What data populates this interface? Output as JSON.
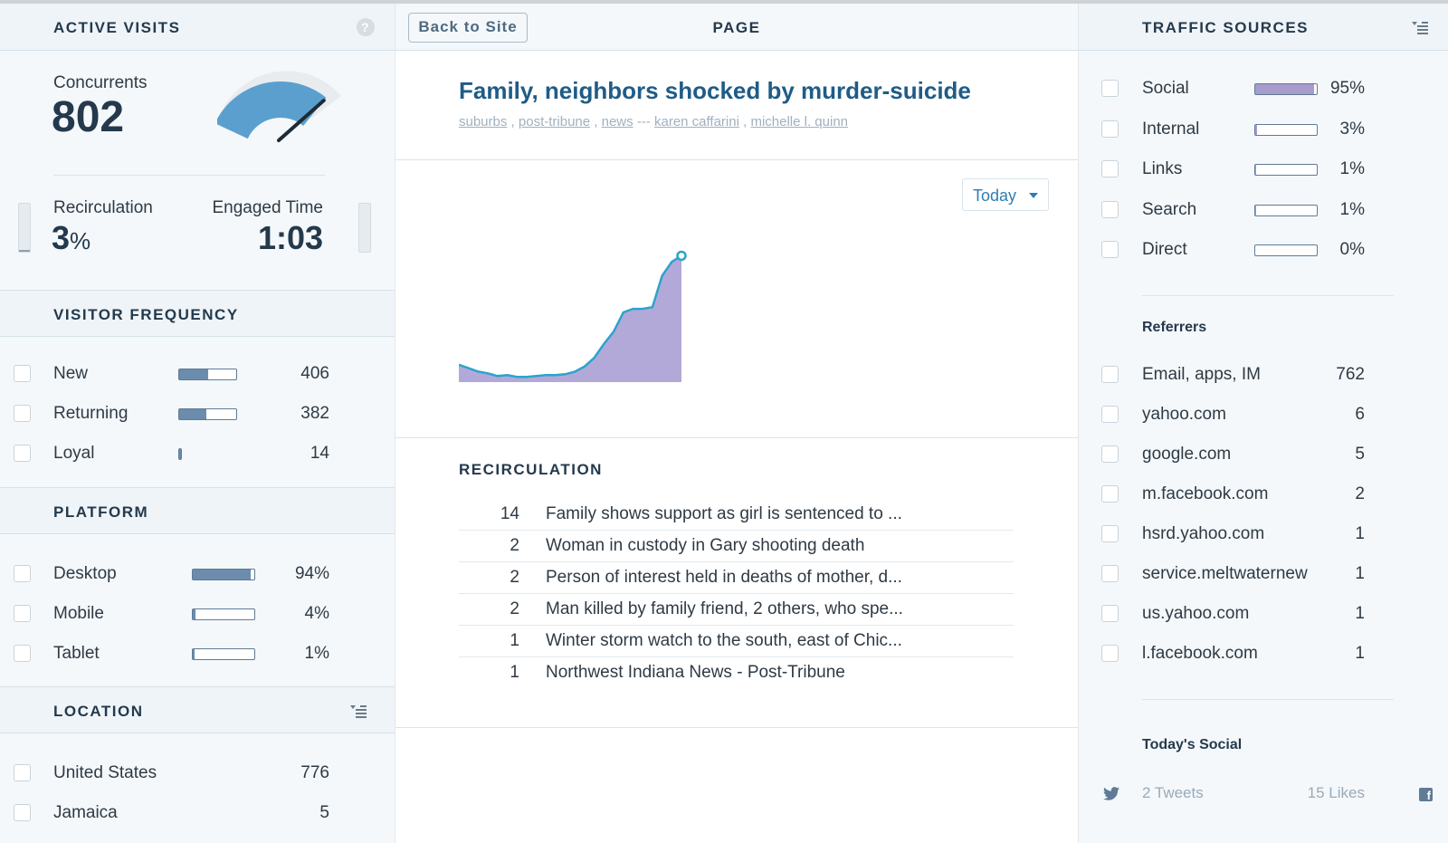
{
  "active_visits": {
    "title": "ACTIVE VISITS",
    "help_icon": "?",
    "concurrents_label": "Concurrents",
    "concurrents_value": "802",
    "gauge_fraction": 0.8,
    "recirculation_label": "Recirculation",
    "recirculation_value": "3",
    "recirculation_unit": "%",
    "engaged_label": "Engaged Time",
    "engaged_value": "1:03"
  },
  "visitor_frequency": {
    "title": "VISITOR FREQUENCY",
    "items": [
      {
        "label": "New",
        "value": "406",
        "fraction": 0.51
      },
      {
        "label": "Returning",
        "value": "382",
        "fraction": 0.48
      },
      {
        "label": "Loyal",
        "value": "14",
        "fraction": 0.02
      }
    ]
  },
  "platform": {
    "title": "PLATFORM",
    "items": [
      {
        "label": "Desktop",
        "value": "94%",
        "fraction": 0.94
      },
      {
        "label": "Mobile",
        "value": "4%",
        "fraction": 0.04
      },
      {
        "label": "Tablet",
        "value": "1%",
        "fraction": 0.01
      }
    ]
  },
  "location": {
    "title": "LOCATION",
    "items": [
      {
        "label": "United States",
        "value": "776"
      },
      {
        "label": "Jamaica",
        "value": "5"
      }
    ]
  },
  "page": {
    "title": "PAGE",
    "back_label": "Back to Site",
    "article_title": "Family, neighbors shocked by murder-suicide",
    "tags": [
      "suburbs",
      "post-tribune",
      "news"
    ],
    "authors": [
      "karen caffarini",
      "michelle l. quinn"
    ],
    "tag_sep": " , ",
    "author_sep": " --- ",
    "range_label": "Today"
  },
  "chart_data": {
    "type": "area",
    "title": "",
    "xlabel": "",
    "ylabel": "",
    "x": [
      0,
      1,
      2,
      3,
      4,
      5,
      6,
      7,
      8,
      9,
      10,
      11,
      12,
      13,
      14,
      15,
      16,
      17,
      18,
      19,
      20,
      21,
      22,
      23,
      24,
      25,
      26,
      27,
      28
    ],
    "series": [
      {
        "values": [
          20,
          16,
          12,
          10,
          7,
          8,
          6,
          6,
          7,
          8,
          8,
          9,
          12,
          18,
          28,
          44,
          58,
          80,
          84,
          84,
          86,
          122,
          138,
          145
        ]
      }
    ],
    "ylim": [
      0,
      160
    ],
    "grid": false,
    "colors": {
      "fill": "#b3a9d8",
      "line": "#2ba4cc"
    }
  },
  "recirculation": {
    "title": "RECIRCULATION",
    "items": [
      {
        "count": "14",
        "title": "Family shows support as girl is sentenced to ..."
      },
      {
        "count": "2",
        "title": "Woman in custody in Gary shooting death"
      },
      {
        "count": "2",
        "title": "Person of interest held in deaths of mother, d..."
      },
      {
        "count": "2",
        "title": "Man killed by family friend, 2 others, who spe..."
      },
      {
        "count": "1",
        "title": "Winter storm watch to the south, east of Chic..."
      },
      {
        "count": "1",
        "title": "Northwest Indiana News - Post-Tribune"
      }
    ]
  },
  "traffic_sources": {
    "title": "TRAFFIC SOURCES",
    "items": [
      {
        "label": "Social",
        "value": "95%",
        "fraction": 0.95
      },
      {
        "label": "Internal",
        "value": "3%",
        "fraction": 0.03
      },
      {
        "label": "Links",
        "value": "1%",
        "fraction": 0.01
      },
      {
        "label": "Search",
        "value": "1%",
        "fraction": 0.01
      },
      {
        "label": "Direct",
        "value": "0%",
        "fraction": 0.0
      }
    ]
  },
  "referrers": {
    "title": "Referrers",
    "items": [
      {
        "label": "Email, apps, IM",
        "value": "762"
      },
      {
        "label": "yahoo.com",
        "value": "6"
      },
      {
        "label": "google.com",
        "value": "5"
      },
      {
        "label": "m.facebook.com",
        "value": "2"
      },
      {
        "label": "hsrd.yahoo.com",
        "value": "1"
      },
      {
        "label": "service.meltwaternew",
        "value": "1"
      },
      {
        "label": "us.yahoo.com",
        "value": "1"
      },
      {
        "label": "l.facebook.com",
        "value": "1"
      }
    ]
  },
  "todays_social": {
    "title": "Today's Social",
    "tweets": "2 Tweets",
    "likes": "15 Likes"
  },
  "colors": {
    "accent": "#1f5c86",
    "gauge": "#5b9fcf",
    "bar": "#6c8cad",
    "social_bar": "#a89ccd"
  }
}
